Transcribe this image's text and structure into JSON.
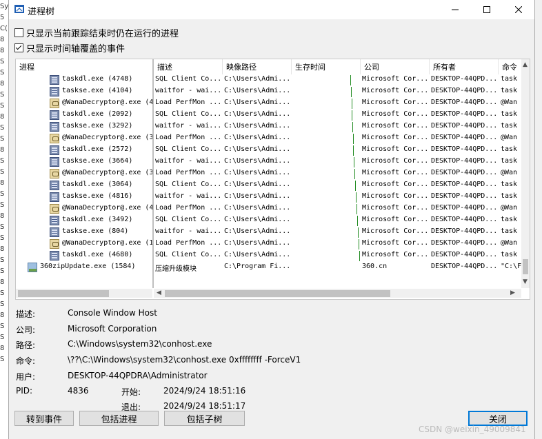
{
  "window": {
    "title": "进程树"
  },
  "titlebar_buttons": [
    {
      "name": "minimize-button",
      "glyph": "—"
    },
    {
      "name": "maximize-button",
      "glyph": "☐"
    },
    {
      "name": "close-window-button",
      "glyph": "✕"
    }
  ],
  "options": {
    "only_running": {
      "label": "只显示当前跟踪结束时仍在运行的进程",
      "checked": false
    },
    "only_timeline": {
      "label": "只显示时间轴覆盖的事件",
      "checked": true
    }
  },
  "columns": [
    "进程",
    "描述",
    "映像路径",
    "生存时间",
    "公司",
    "所有者",
    "命令"
  ],
  "rows": [
    {
      "icon": "exe-icon",
      "process": "taskdl.exe (4748)",
      "desc": "SQL Client Co...",
      "path": "C:\\Users\\Admi...",
      "company": "Microsoft Cor...",
      "owner": "DESKTOP-44QPD...",
      "cmd": "task"
    },
    {
      "icon": "exe-icon",
      "process": "taskse.exe (4104)",
      "desc": "waitfor - wai...",
      "path": "C:\\Users\\Admi...",
      "company": "Microsoft Cor...",
      "owner": "DESKTOP-44QPD...",
      "cmd": "task"
    },
    {
      "icon": "wanadecryptor-icon",
      "process": "@WanaDecryptor@.exe (4",
      "desc": "Load PerfMon ...",
      "path": "C:\\Users\\Admi...",
      "company": "Microsoft Cor...",
      "owner": "DESKTOP-44QPD...",
      "cmd": "@Wan"
    },
    {
      "icon": "exe-icon",
      "process": "taskdl.exe (2092)",
      "desc": "SQL Client Co...",
      "path": "C:\\Users\\Admi...",
      "company": "Microsoft Cor...",
      "owner": "DESKTOP-44QPD...",
      "cmd": "task"
    },
    {
      "icon": "exe-icon",
      "process": "taskse.exe (3292)",
      "desc": "waitfor - wai...",
      "path": "C:\\Users\\Admi...",
      "company": "Microsoft Cor...",
      "owner": "DESKTOP-44QPD...",
      "cmd": "task"
    },
    {
      "icon": "wanadecryptor-icon",
      "process": "@WanaDecryptor@.exe (3",
      "desc": "Load PerfMon ...",
      "path": "C:\\Users\\Admi...",
      "company": "Microsoft Cor...",
      "owner": "DESKTOP-44QPD...",
      "cmd": "@Wan"
    },
    {
      "icon": "exe-icon",
      "process": "taskdl.exe (2572)",
      "desc": "SQL Client Co...",
      "path": "C:\\Users\\Admi...",
      "company": "Microsoft Cor...",
      "owner": "DESKTOP-44QPD...",
      "cmd": "task"
    },
    {
      "icon": "exe-icon",
      "process": "taskse.exe (3664)",
      "desc": "waitfor - wai...",
      "path": "C:\\Users\\Admi...",
      "company": "Microsoft Cor...",
      "owner": "DESKTOP-44QPD...",
      "cmd": "task"
    },
    {
      "icon": "wanadecryptor-icon",
      "process": "@WanaDecryptor@.exe (3",
      "desc": "Load PerfMon ...",
      "path": "C:\\Users\\Admi...",
      "company": "Microsoft Cor...",
      "owner": "DESKTOP-44QPD...",
      "cmd": "@Wan"
    },
    {
      "icon": "exe-icon",
      "process": "taskdl.exe (3064)",
      "desc": "SQL Client Co...",
      "path": "C:\\Users\\Admi...",
      "company": "Microsoft Cor...",
      "owner": "DESKTOP-44QPD...",
      "cmd": "task"
    },
    {
      "icon": "exe-icon",
      "process": "taskse.exe (4816)",
      "desc": "waitfor - wai...",
      "path": "C:\\Users\\Admi...",
      "company": "Microsoft Cor...",
      "owner": "DESKTOP-44QPD...",
      "cmd": "task"
    },
    {
      "icon": "wanadecryptor-icon",
      "process": "@WanaDecryptor@.exe (4",
      "desc": "Load PerfMon ...",
      "path": "C:\\Users\\Admi...",
      "company": "Microsoft Cor...",
      "owner": "DESKTOP-44QPD...",
      "cmd": "@Wan"
    },
    {
      "icon": "exe-icon",
      "process": "taskdl.exe (3492)",
      "desc": "SQL Client Co...",
      "path": "C:\\Users\\Admi...",
      "company": "Microsoft Cor...",
      "owner": "DESKTOP-44QPD...",
      "cmd": "task"
    },
    {
      "icon": "exe-icon",
      "process": "taskse.exe (804)",
      "desc": "waitfor - wai...",
      "path": "C:\\Users\\Admi...",
      "company": "Microsoft Cor...",
      "owner": "DESKTOP-44QPD...",
      "cmd": "task"
    },
    {
      "icon": "wanadecryptor-icon",
      "process": "@WanaDecryptor@.exe (1",
      "desc": "Load PerfMon ...",
      "path": "C:\\Users\\Admi...",
      "company": "Microsoft Cor...",
      "owner": "DESKTOP-44QPD...",
      "cmd": "@Wan"
    },
    {
      "icon": "exe-icon",
      "process": "taskdl.exe (4680)",
      "desc": "SQL Client Co...",
      "path": "C:\\Users\\Admi...",
      "company": "Microsoft Cor...",
      "owner": "DESKTOP-44QPD...",
      "cmd": "task"
    },
    {
      "icon": "360update-icon",
      "process": "360zipUpdate.exe (1584)",
      "desc": "压缩升级模块",
      "path": "C:\\Program Fi...",
      "company": "360.cn",
      "owner": "DESKTOP-44QPD...",
      "cmd": "\"C:\\F"
    }
  ],
  "details": {
    "description": {
      "label": "描述:",
      "value": "Console Window Host"
    },
    "company": {
      "label": "公司:",
      "value": "Microsoft Corporation"
    },
    "path": {
      "label": "路径:",
      "value": "C:\\Windows\\system32\\conhost.exe"
    },
    "command": {
      "label": "命令:",
      "value": "\\??\\C:\\Windows\\system32\\conhost.exe 0xffffffff -ForceV1"
    },
    "user": {
      "label": "用户:",
      "value": "DESKTOP-44QPDRA\\Administrator"
    },
    "pid": {
      "label": "PID:",
      "value": "4836"
    },
    "start": {
      "label": "开始:",
      "value": "2024/9/24 18:51:16"
    },
    "exit": {
      "label": "退出:",
      "value": "2024/9/24 18:51:17"
    }
  },
  "buttons": {
    "goto_event": "转到事件",
    "include_process": "包括进程",
    "include_subtree": "包括子树",
    "close": "关闭"
  },
  "watermark": "CSDN @weixin_49009841",
  "background_glyphs": [
    "Sy",
    "5",
    "C(",
    "8",
    "8",
    "S",
    "S",
    "8",
    "S",
    "S",
    "8",
    "S",
    "S",
    "8",
    "S",
    "S",
    "8",
    "S",
    "S",
    "8",
    "S",
    "S",
    "8",
    "S",
    "S",
    "8",
    "S",
    "S",
    "8",
    "S",
    "S",
    "8",
    "S"
  ],
  "colors": {
    "timeline_bar": "#1f8a1f",
    "default_button_border": "#0078d7",
    "title_icon": "#1f5fb4"
  }
}
